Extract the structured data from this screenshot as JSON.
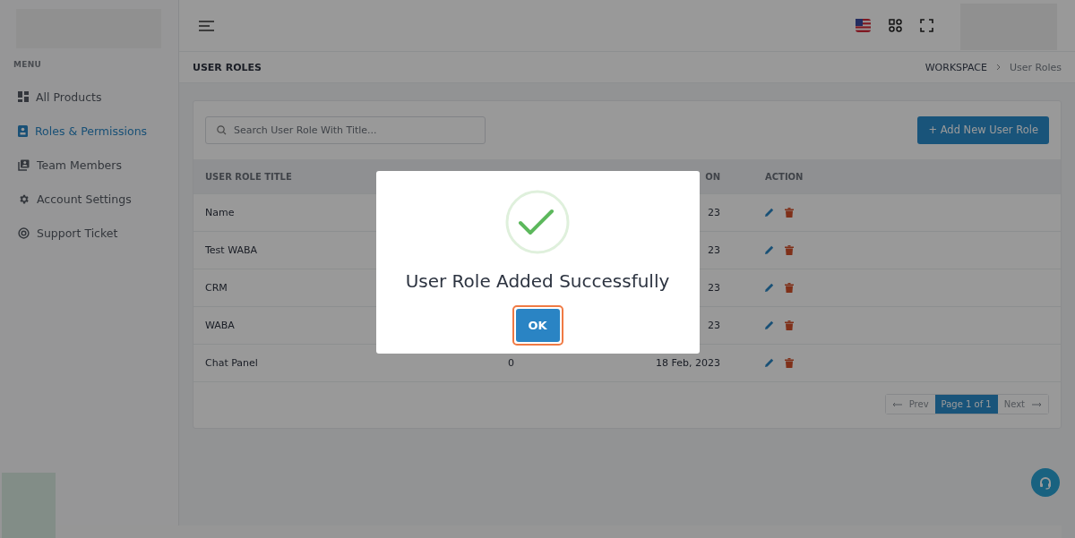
{
  "sidebar": {
    "menu_label": "MENU",
    "items": [
      {
        "label": "All Products",
        "selected": false
      },
      {
        "label": "Roles & Permissions",
        "selected": true
      },
      {
        "label": "Team Members",
        "selected": false
      },
      {
        "label": "Account Settings",
        "selected": false
      },
      {
        "label": "Support Ticket",
        "selected": false
      }
    ]
  },
  "page_title": "USER ROLES",
  "breadcrumb": [
    "WORKSPACE",
    "User Roles"
  ],
  "search": {
    "placeholder": "Search User Role With Title..."
  },
  "add_button": "+ Add New User Role",
  "table": {
    "columns": {
      "title": "USER ROLE TITLE",
      "created": "ON",
      "action": "ACTION"
    },
    "rows": [
      {
        "title": "Name",
        "created": "23"
      },
      {
        "title": "Test WABA",
        "created": "23"
      },
      {
        "title": "CRM",
        "created": "23"
      },
      {
        "title": "WABA",
        "created": "23"
      },
      {
        "title": "Chat Panel",
        "users": "0",
        "created": "18 Feb, 2023"
      }
    ]
  },
  "pagination": [
    {
      "label": "Prev",
      "kind": "prev",
      "selected": false
    },
    {
      "label": "Page 1 of 1",
      "kind": "page",
      "selected": true
    },
    {
      "label": "Next",
      "kind": "next",
      "selected": false
    }
  ],
  "dialog": {
    "message": "User Role Added Successfully",
    "button": "OK"
  }
}
